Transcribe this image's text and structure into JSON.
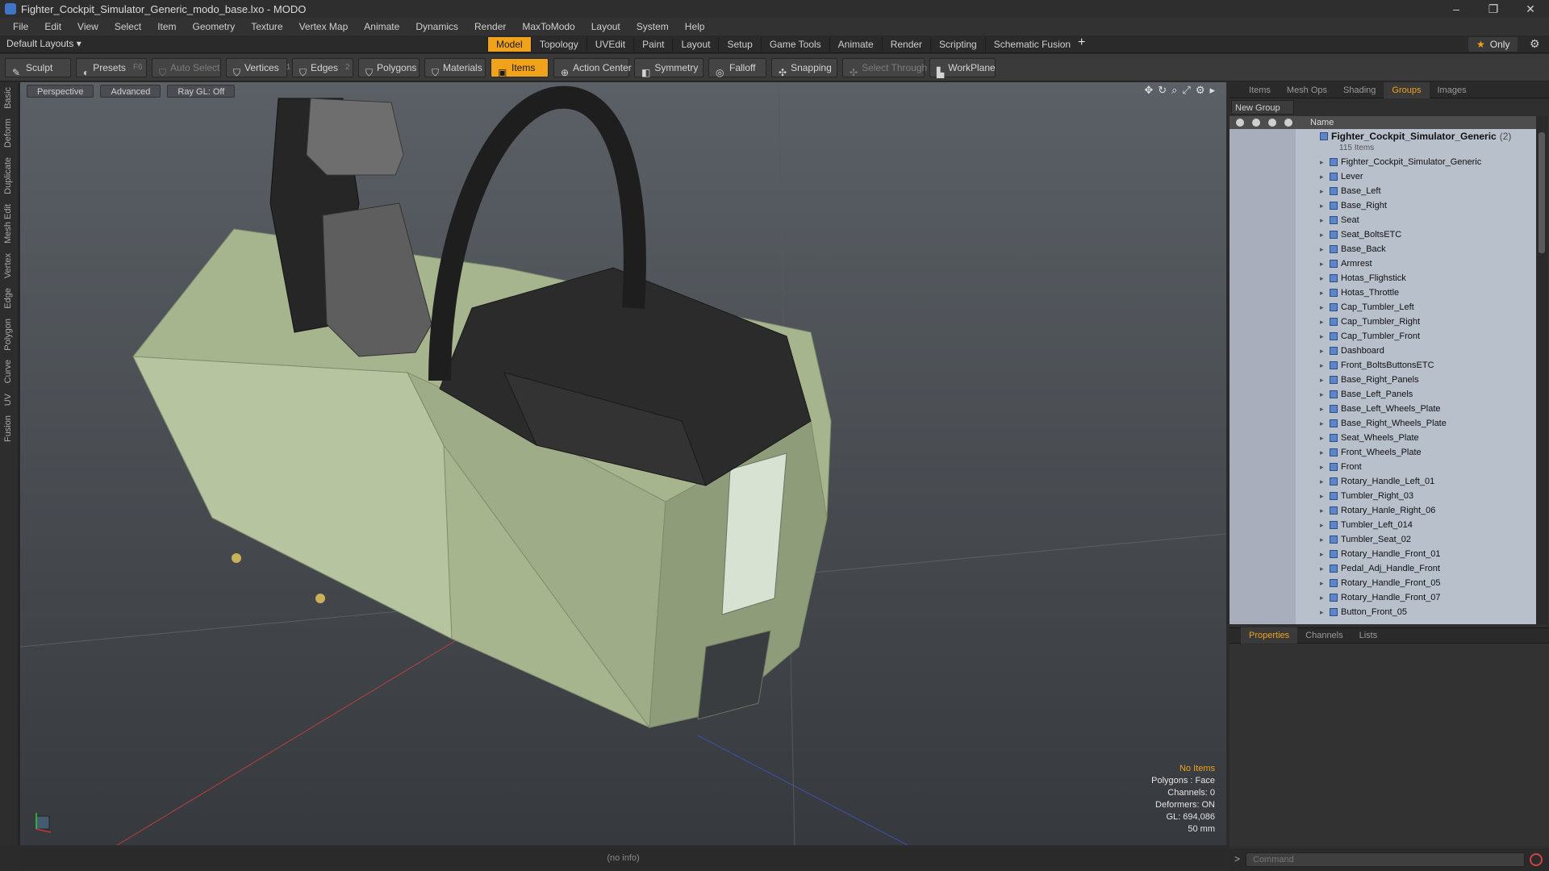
{
  "window": {
    "title": "Fighter_Cockpit_Simulator_Generic_modo_base.lxo - MODO",
    "controls": [
      "–",
      "❐",
      "✕"
    ]
  },
  "menu": [
    "File",
    "Edit",
    "View",
    "Select",
    "Item",
    "Geometry",
    "Texture",
    "Vertex Map",
    "Animate",
    "Dynamics",
    "Render",
    "MaxToModo",
    "Layout",
    "System",
    "Help"
  ],
  "layout": {
    "selector": "Default Layouts ▾",
    "tabs": [
      "Model",
      "Topology",
      "UVEdit",
      "Paint",
      "Layout",
      "Setup",
      "Game Tools",
      "Animate",
      "Render",
      "Scripting",
      "Schematic Fusion"
    ],
    "active_tab": "Model",
    "only_label": "Only"
  },
  "toolbar": {
    "sculpt": "Sculpt",
    "presets": "Presets",
    "presets_hotkey": "F6",
    "auto_select": "Auto Select",
    "vertices": "Vertices",
    "vertices_hotkey": "1",
    "edges": "Edges",
    "edges_hotkey": "2",
    "polygons": "Polygons",
    "materials": "Materials",
    "items": "Items",
    "action_center": "Action Center",
    "symmetry": "Symmetry",
    "falloff": "Falloff",
    "snapping": "Snapping",
    "select_through": "Select Through",
    "workplane": "WorkPlane"
  },
  "left_tabs": [
    "Basic",
    "Deform",
    "Duplicate",
    "Mesh Edit",
    "Vertex",
    "Edge",
    "Polygon",
    "Curve",
    "UV",
    "Fusion"
  ],
  "viewport": {
    "view": "Perspective",
    "shading": "Advanced",
    "raygl": "Ray GL: Off",
    "info": {
      "selection": "No Items",
      "polygons": "Polygons : Face",
      "channels": "Channels: 0",
      "deformers": "Deformers: ON",
      "gl": "GL: 694,086",
      "lens": "50 mm"
    }
  },
  "status": "(no info)",
  "right_panel": {
    "tabs": [
      "Items",
      "Mesh Ops",
      "Shading",
      "Groups",
      "Images"
    ],
    "active_tab": "Groups",
    "new_group": "New Group",
    "column_name": "Name",
    "root": {
      "name": "Fighter_Cockpit_Simulator_Generic",
      "count": "(2)",
      "sub": "115 Items"
    },
    "items": [
      "Fighter_Cockpit_Simulator_Generic",
      "Lever",
      "Base_Left",
      "Base_Right",
      "Seat",
      "Seat_BoltsETC",
      "Base_Back",
      "Armrest",
      "Hotas_Flighstick",
      "Hotas_Throttle",
      "Cap_Tumbler_Left",
      "Cap_Tumbler_Right",
      "Cap_Tumbler_Front",
      "Dashboard",
      "Front_BoltsButtonsETC",
      "Base_Right_Panels",
      "Base_Left_Panels",
      "Base_Left_Wheels_Plate",
      "Base_Right_Wheels_Plate",
      "Seat_Wheels_Plate",
      "Front_Wheels_Plate",
      "Front",
      "Rotary_Handle_Left_01",
      "Tumbler_Right_03",
      "Rotary_Hanle_Right_06",
      "Tumbler_Left_014",
      "Tumbler_Seat_02",
      "Rotary_Handle_Front_01",
      "Pedal_Adj_Handle_Front",
      "Rotary_Handle_Front_05",
      "Rotary_Handle_Front_07",
      "Button_Front_05"
    ],
    "props_tabs": [
      "Properties",
      "Channels",
      "Lists"
    ],
    "props_active": "Properties",
    "command_placeholder": "Command"
  },
  "colors": {
    "accent": "#f0a21a",
    "cockpit_green": "#a7b58f",
    "cockpit_dark": "#2a2a2a"
  }
}
